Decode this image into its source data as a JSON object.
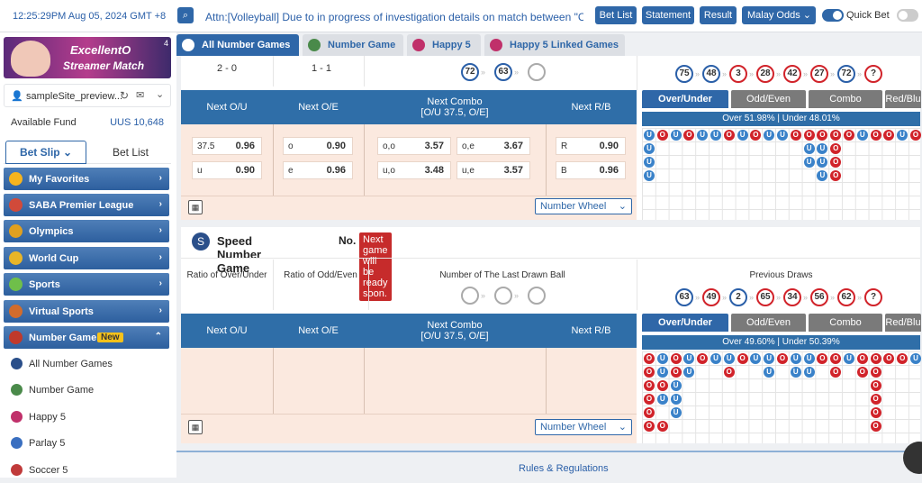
{
  "topbar": {
    "time": "12:25:29PM Aug 05, 2024 GMT +8",
    "ticker": "Attn:[Volleyball] Due to in progress of investigation details on match between \"Club",
    "bet_list": "Bet List",
    "statement": "Statement",
    "result": "Result",
    "odds": "Malay Odds",
    "quick_bet": "Quick Bet"
  },
  "sidebar": {
    "banner_line1": "ExcellentO",
    "banner_line2": "Streamer Match",
    "banner_num": "4",
    "username": "sampleSite_preview...",
    "fund_label": "Available Fund",
    "fund_value": "UUS 10,648",
    "tab_betslip": "Bet Slip",
    "tab_betlist": "Bet List",
    "menu": [
      {
        "label": "My Favorites",
        "color": "#f6b41e"
      },
      {
        "label": "SABA Premier League",
        "color": "#d14a3a"
      },
      {
        "label": "Olympics",
        "color": "#e0a020"
      },
      {
        "label": "World Cup",
        "color": "#e8b528"
      },
      {
        "label": "Sports",
        "color": "#6fbf4a"
      },
      {
        "label": "Virtual Sports",
        "color": "#d26c2c"
      },
      {
        "label": "Number Game",
        "color": "#c0392b",
        "badge": "New"
      }
    ],
    "sub": [
      {
        "label": "All Number Games",
        "color": "#2a4f8a"
      },
      {
        "label": "Number Game",
        "color": "#4a8a4a"
      },
      {
        "label": "Happy 5",
        "color": "#c0306a"
      },
      {
        "label": "Parlay 5",
        "color": "#3a6fc0"
      },
      {
        "label": "Soccer 5",
        "color": "#c03a3a"
      }
    ]
  },
  "game_tabs": [
    {
      "label": "All Number Games",
      "active": true
    },
    {
      "label": "Number Game"
    },
    {
      "label": "Happy 5"
    },
    {
      "label": "Happy 5 Linked Games"
    }
  ],
  "top_game": {
    "ou_ratio": "2 - 0",
    "oe_ratio": "1 - 1",
    "last_balls": [
      "72",
      "63",
      ""
    ],
    "prev_balls": [
      "75",
      "48",
      "3",
      "28",
      "42",
      "27",
      "72",
      "?"
    ],
    "head": {
      "ou": "Next O/U",
      "oe": "Next O/E",
      "combo1": "Next Combo",
      "combo2": "[O/U 37.5, O/E]",
      "rb": "Next R/B"
    },
    "odds": {
      "ou_line": "37.5",
      "over": "0.96",
      "u_label": "u",
      "under": "0.90",
      "o_label": "o",
      "odd": "0.90",
      "e_label": "e",
      "even": "0.96",
      "oo_label": "o,o",
      "oo": "3.57",
      "oe_label": "o,e",
      "oe": "3.67",
      "uo_label": "u,o",
      "uo": "3.48",
      "ue_label": "u,e",
      "ue": "3.57",
      "r_label": "R",
      "red": "0.90",
      "b_label": "B",
      "blue": "0.96"
    },
    "wheel": "Number Wheel",
    "rtabs": [
      "Over/Under",
      "Odd/Even",
      "Combo",
      "Red/Blu"
    ],
    "stats": "Over 51.98% | Under 48.01%"
  },
  "speed_game": {
    "title": "Speed Number Game",
    "no_label": "No.",
    "ready": "Next game will be ready soon.",
    "h_ou": "Ratio of Over/Under",
    "h_oe": "Ratio of Odd/Even",
    "h_last": "Number of The Last Drawn Ball",
    "h_prev": "Previous Draws",
    "prev_balls": [
      "63",
      "49",
      "2",
      "65",
      "34",
      "56",
      "62",
      "?"
    ],
    "head": {
      "ou": "Next O/U",
      "oe": "Next O/E",
      "combo1": "Next Combo",
      "combo2": "[O/U 37.5, O/E]",
      "rb": "Next R/B"
    },
    "wheel": "Number Wheel",
    "rtabs": [
      "Over/Under",
      "Odd/Even",
      "Combo",
      "Red/Blu"
    ],
    "stats": "Over 49.60% | Under 50.39%"
  },
  "footer": {
    "rules": "Rules & Regulations"
  }
}
